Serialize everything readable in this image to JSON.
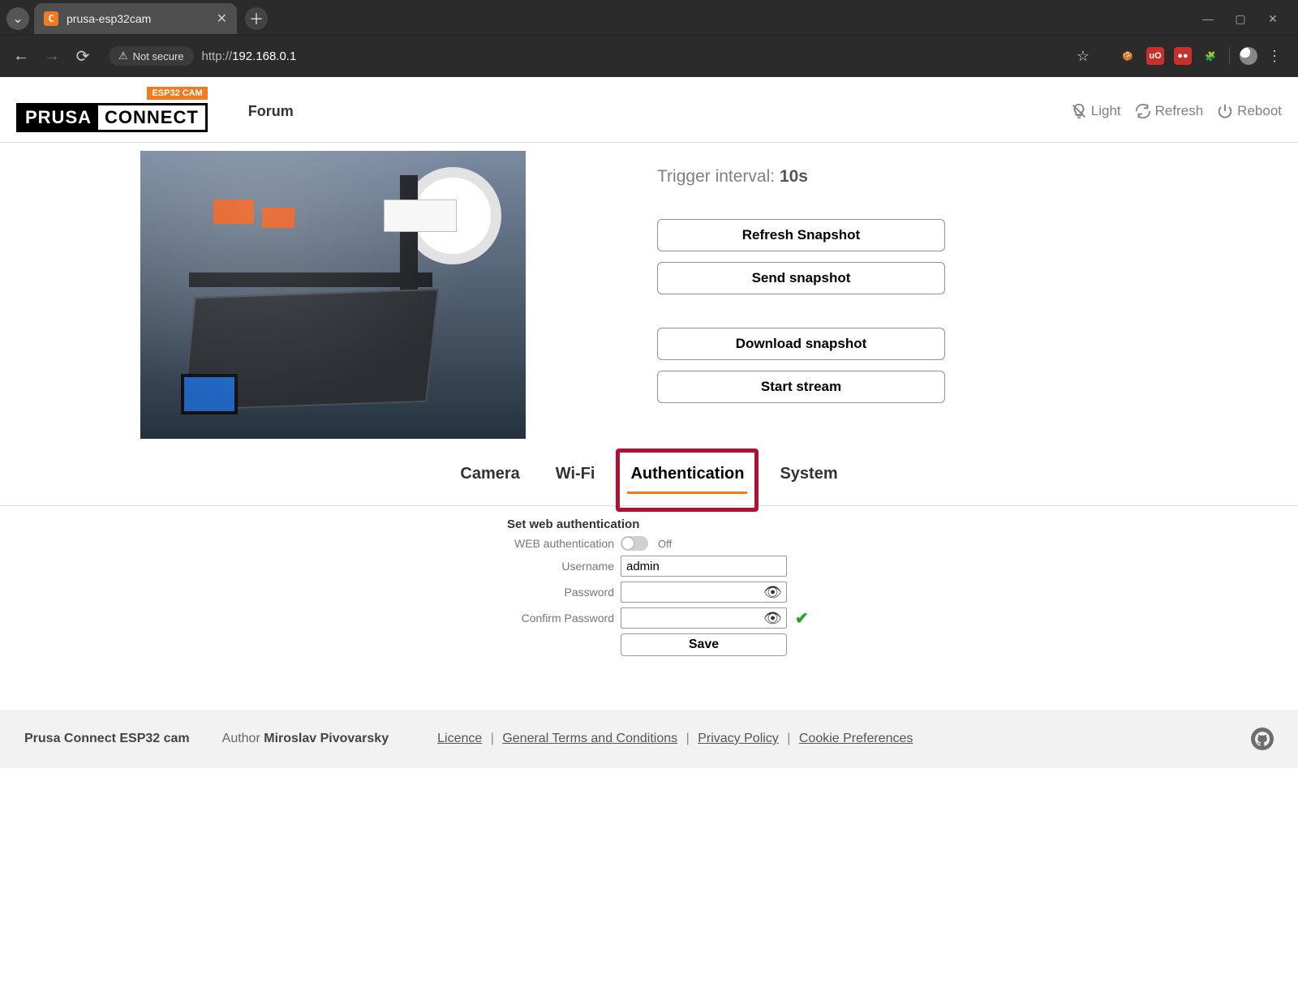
{
  "browser": {
    "tab_title": "prusa-esp32cam",
    "not_secure": "Not secure",
    "url_scheme": "http://",
    "url_host": "192.168.0.1"
  },
  "header": {
    "logo_badge": "ESP32 CAM",
    "logo_left": "PRUSA",
    "logo_right": "CONNECT",
    "forum": "Forum",
    "actions": {
      "light": "Light",
      "refresh": "Refresh",
      "reboot": "Reboot"
    }
  },
  "snapshot_panel": {
    "trigger_label": "Trigger interval: ",
    "trigger_value": "10s",
    "buttons": {
      "refresh": "Refresh Snapshot",
      "send": "Send snapshot",
      "download": "Download snapshot",
      "stream": "Start stream"
    }
  },
  "tabs": {
    "camera": "Camera",
    "wifi": "Wi-Fi",
    "auth": "Authentication",
    "system": "System",
    "active": "auth"
  },
  "auth_form": {
    "title": "Set web authentication",
    "labels": {
      "web_auth": "WEB authentication",
      "username": "Username",
      "password": "Password",
      "confirm": "Confirm Password"
    },
    "toggle_state": "Off",
    "username_value": "admin",
    "password_value": "",
    "confirm_value": "",
    "save": "Save"
  },
  "footer": {
    "product": "Prusa Connect ESP32 cam",
    "by": "Author ",
    "author": "Miroslav Pivovarsky",
    "links": {
      "licence": "Licence",
      "terms": "General Terms and Conditions",
      "privacy": "Privacy Policy",
      "cookies": "Cookie Preferences"
    }
  }
}
